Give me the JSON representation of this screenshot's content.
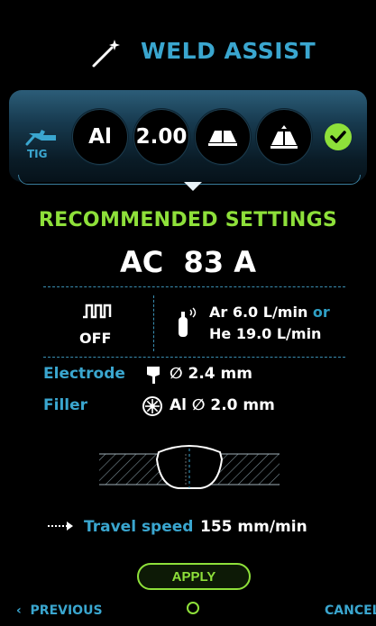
{
  "header": {
    "title": "WELD ASSIST",
    "icon": "magic-wand-icon"
  },
  "selection": {
    "process_label": "TIG",
    "material": "Al",
    "thickness": "2.00",
    "joint_icon": "open-book-joint-icon",
    "position_icon": "upright-joint-icon",
    "status_icon": "check-icon"
  },
  "recommended": {
    "title": "RECOMMENDED SETTINGS",
    "main_value": "AC  83 A",
    "pulse_state": "OFF",
    "gas_line1": "Ar 6.0 L/min",
    "gas_or": "or",
    "gas_line2": "He 19.0 L/min",
    "electrode_label": "Electrode",
    "electrode_value": "2.4 mm",
    "filler_label": "Filler",
    "filler_material": "Al",
    "filler_value": "2.0 mm",
    "diameter_symbol": "∅",
    "travel_label": "Travel speed",
    "travel_value": "155 mm/min"
  },
  "actions": {
    "apply_label": "APPLY"
  },
  "nav": {
    "previous_label": "PREVIOUS",
    "previous_chevron": "‹",
    "cancel_label": "CANCEL"
  },
  "colors": {
    "accent_blue": "#3aa6cf",
    "accent_green": "#8ee03a",
    "background": "#000000"
  }
}
